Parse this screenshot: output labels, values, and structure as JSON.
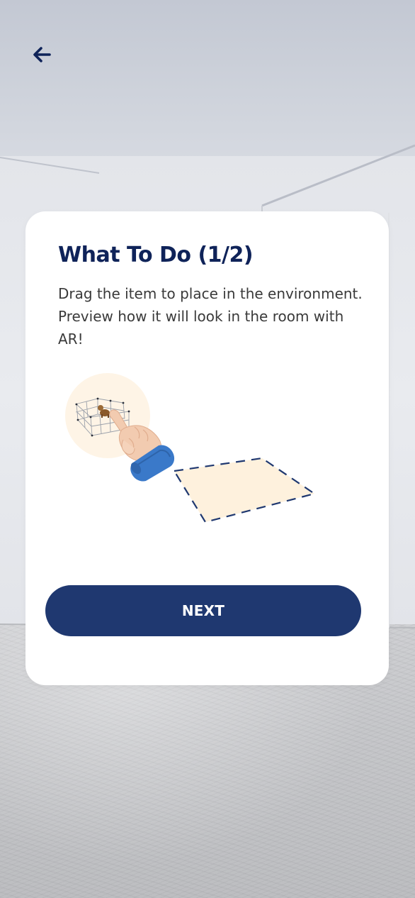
{
  "navigation": {
    "back_icon": "arrow-left-icon"
  },
  "dialog": {
    "title": "What To Do (1/2)",
    "description": "Drag the item to place in the environment. Preview how it will look in the room with AR!",
    "illustration_icons": [
      "pet-playpen-icon",
      "pointing-hand-icon",
      "placement-area-icon"
    ],
    "next_label": "NEXT"
  },
  "colors": {
    "accent": "#1f3870",
    "title": "#0f2359",
    "placement_area": "#fef1dd",
    "skin": "#f2cbb0",
    "sleeve": "#3a79c9"
  }
}
